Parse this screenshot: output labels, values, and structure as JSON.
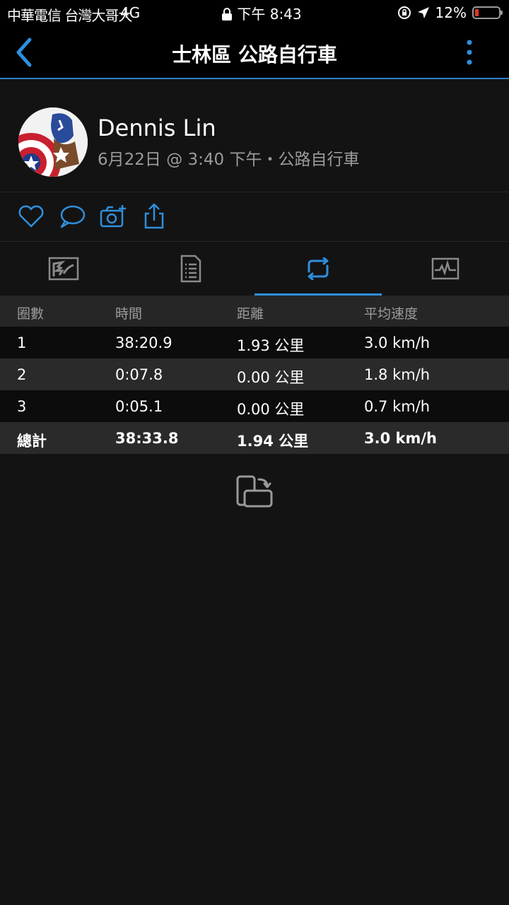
{
  "status_bar": {
    "carrier": "中華電信 台灣大哥大",
    "network": "4G",
    "time": "下午 8:43",
    "battery": "12%",
    "battery_level": 0.12
  },
  "nav": {
    "title": "士林區 公路自行車",
    "back_icon": "chevron-left-icon",
    "more_icon": "vertical-ellipsis-icon"
  },
  "profile": {
    "name": "Dennis Lin",
    "meta": "6月22日 @ 3:40 下午・公路自行車"
  },
  "actions": [
    "heart-icon",
    "comment-icon",
    "add-photo-icon",
    "share-icon"
  ],
  "tabs": [
    "map-tab-icon",
    "details-tab-icon",
    "laps-tab-icon",
    "chart-tab-icon"
  ],
  "active_tab": 2,
  "laps": {
    "headers": [
      "圈數",
      "時間",
      "距離",
      "平均速度"
    ],
    "rows": [
      [
        "1",
        "38:20.9",
        "1.93 公里",
        "3.0 km/h"
      ],
      [
        "2",
        "0:07.8",
        "0.00 公里",
        "1.8 km/h"
      ],
      [
        "3",
        "0:05.1",
        "0.00 公里",
        "0.7 km/h"
      ]
    ],
    "total": [
      "總計",
      "38:33.8",
      "1.94 公里",
      "3.0 km/h"
    ]
  },
  "colors": {
    "accent": "#2f8fdc",
    "background": "#131313",
    "header_row": "#262626",
    "battery_low": "#e5332a"
  }
}
